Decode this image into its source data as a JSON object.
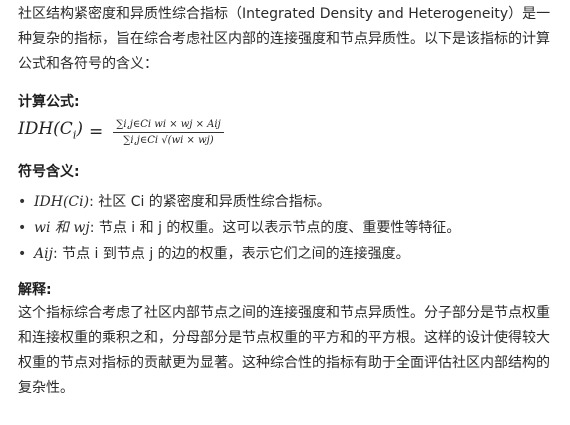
{
  "intro": {
    "text": "社区结构紧密度和异质性综合指标（Integrated Density and Heterogeneity）是一种复杂的指标，旨在综合考虑社区内部的连接强度和节点异质性。以下是该指标的计算公式和各符号的含义："
  },
  "formula_section": {
    "heading": "计算公式:",
    "lhs": "IDH(C",
    "lhs_sub": "i",
    "lhs_close": ")",
    "equals": "=",
    "numerator": "∑i,j∈Ci wi × wj × Aij",
    "denominator": "∑i,j∈Ci √(wi × wj)"
  },
  "symbols_section": {
    "heading": "符号含义:",
    "items": [
      {
        "math": "IDH(Ci)",
        "text": ": 社区 Ci 的紧密度和异质性综合指标。"
      },
      {
        "math": "wi 和 wj",
        "text": ": 节点 i 和 j 的权重。这可以表示节点的度、重要性等特征。"
      },
      {
        "math": "Aij",
        "text": ": 节点 i 到节点 j 的边的权重，表示它们之间的连接强度。"
      }
    ]
  },
  "explanation_section": {
    "heading": "解释:",
    "text": "这个指标综合考虑了社区内部节点之间的连接强度和节点异质性。分子部分是节点权重和连接权重的乘积之和，分母部分是节点权重的平方和的平方根。这样的设计使得较大权重的节点对指标的贡献更为显著。这种综合性的指标有助于全面评估社区内部结构的复杂性。"
  }
}
